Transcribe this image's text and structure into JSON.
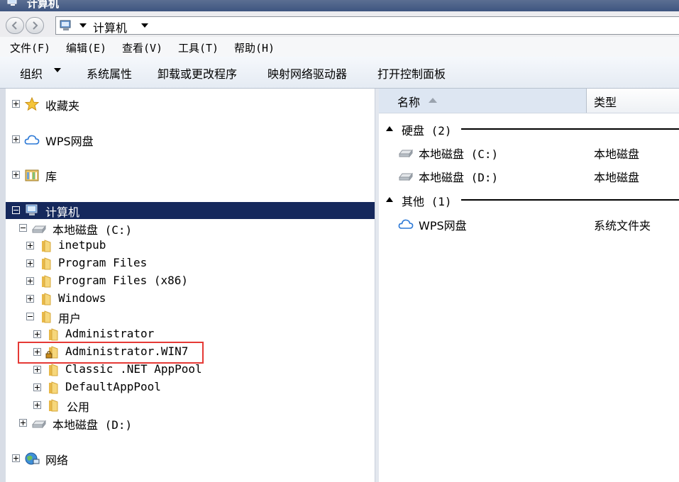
{
  "window": {
    "title": "计算机"
  },
  "address": {
    "crumb": "计算机"
  },
  "menu": [
    "文件(F)",
    "编辑(E)",
    "查看(V)",
    "工具(T)",
    "帮助(H)"
  ],
  "toolbar": {
    "organize": "组织",
    "items": [
      "系统属性",
      "卸载或更改程序",
      "映射网络驱动器",
      "打开控制面板"
    ]
  },
  "nav": {
    "favorites": "收藏夹",
    "wps": "WPS网盘",
    "libraries": "库",
    "computer": "计算机",
    "drive_c": "本地磁盘 (C:)",
    "folders_c": [
      "inetpub",
      "Program Files",
      "Program Files (x86)",
      "Windows"
    ],
    "users": "用户",
    "user_folders": [
      "Administrator",
      "Administrator.WIN7",
      "Classic .NET AppPool",
      "DefaultAppPool",
      "公用"
    ],
    "drive_d": "本地磁盘 (D:)",
    "network": "网络"
  },
  "content": {
    "columns": {
      "name": "名称",
      "type": "类型"
    },
    "groups": [
      {
        "title": "硬盘 (2)",
        "items": [
          {
            "name": "本地磁盘 (C:)",
            "type": "本地磁盘"
          },
          {
            "name": "本地磁盘 (D:)",
            "type": "本地磁盘"
          }
        ]
      },
      {
        "title": "其他 (1)",
        "items": [
          {
            "name": "WPS网盘",
            "type": "系统文件夹"
          }
        ]
      }
    ]
  }
}
